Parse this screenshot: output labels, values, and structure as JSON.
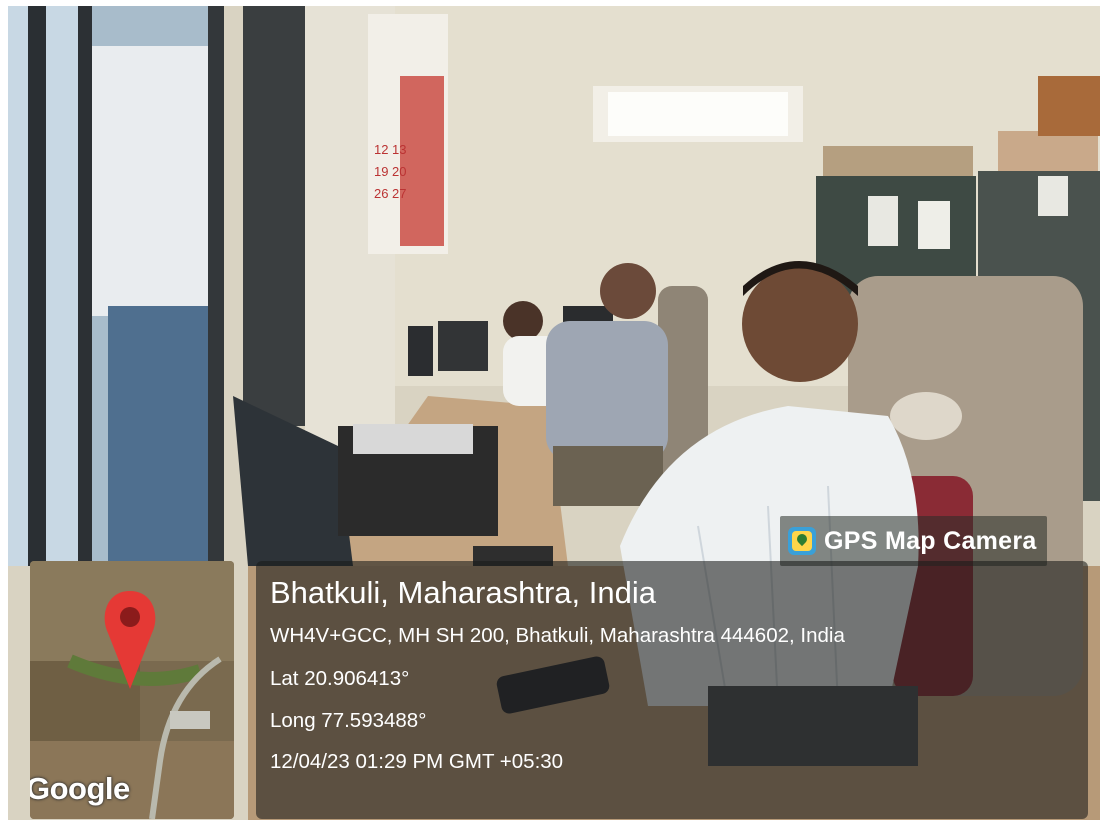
{
  "badge": {
    "icon": "gps-map-camera-app-icon",
    "label": "GPS Map Camera"
  },
  "location": {
    "title": "Bhatkuli, Maharashtra, India",
    "address": "WH4V+GCC, MH SH 200, Bhatkuli, Maharashtra 444602, India",
    "latitude": "Lat 20.906413°",
    "longitude": "Long 77.593488°",
    "datetime": "12/04/23 01:29 PM GMT +05:30"
  },
  "map": {
    "attribution": "Google",
    "pin_icon": "map-pin-icon",
    "pin_color": "#e53935"
  },
  "calendar_numbers": [
    "12",
    "13",
    "19",
    "20",
    "26",
    "27"
  ]
}
